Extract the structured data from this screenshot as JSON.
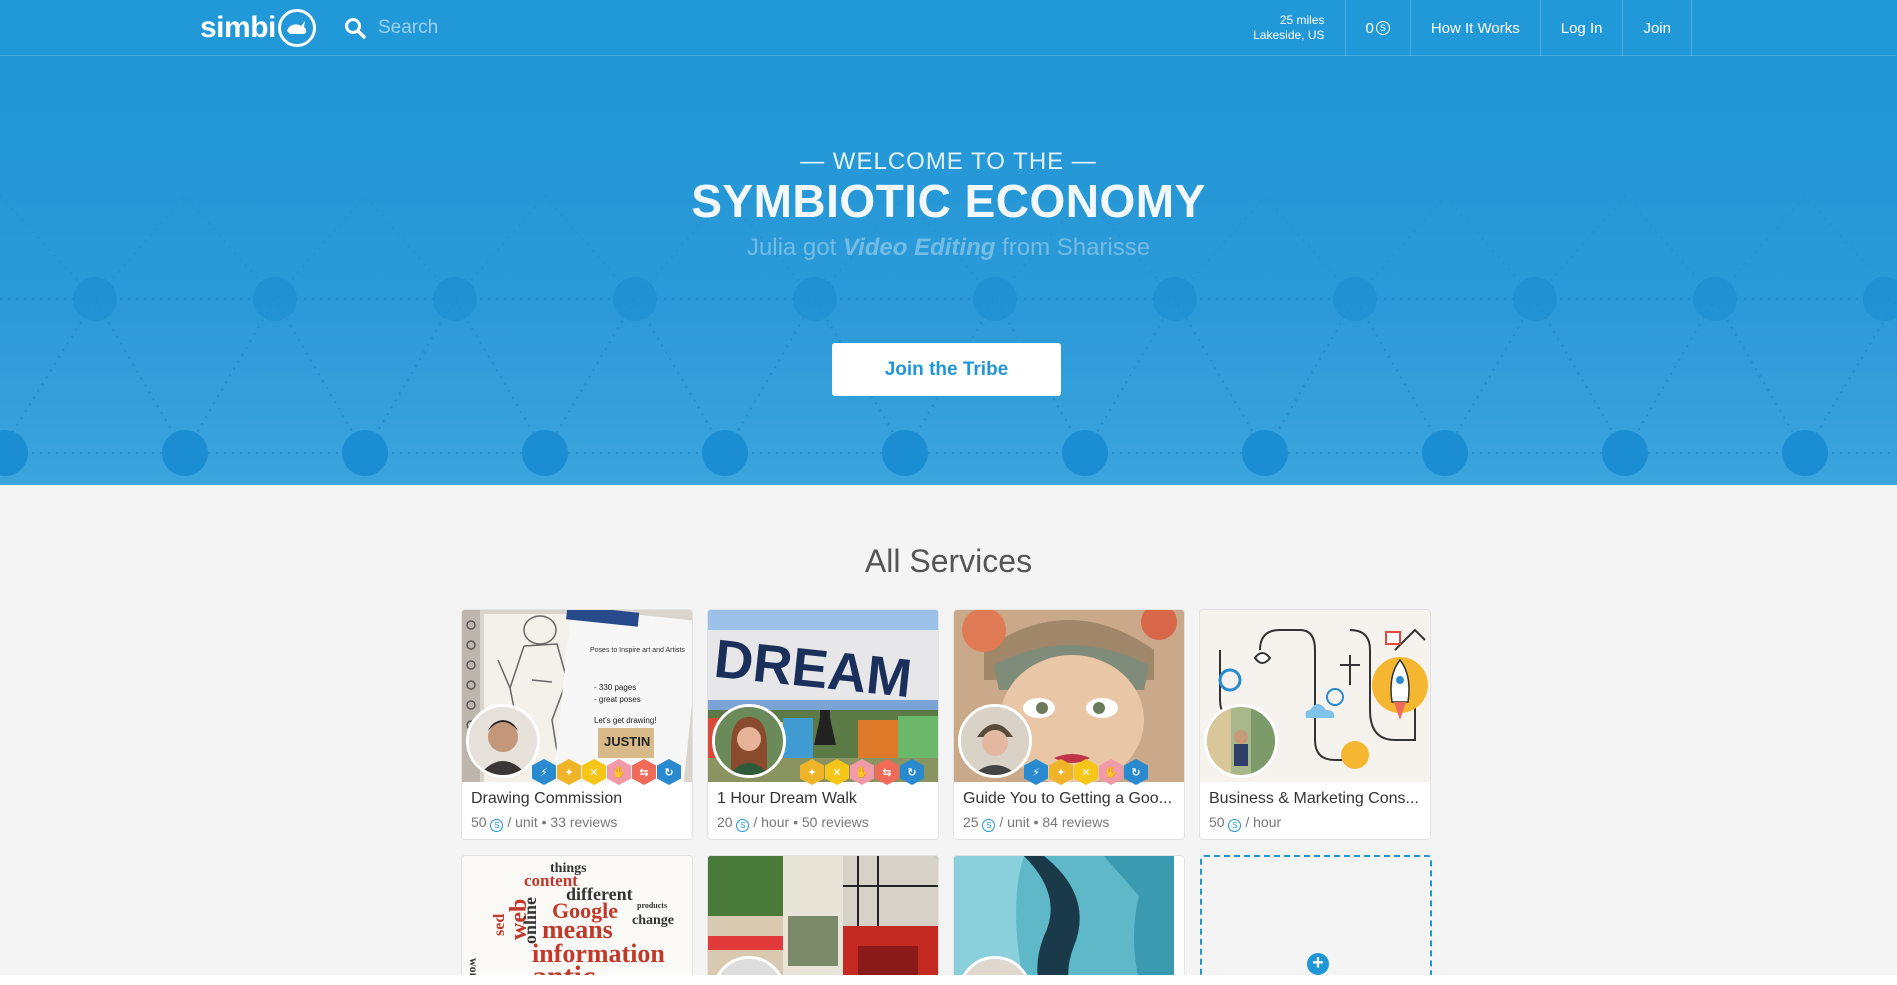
{
  "nav": {
    "logo_text": "simbi",
    "search_placeholder": "Search",
    "distance": "25 miles",
    "location": "Lakeside, US",
    "balance": "0",
    "how_it_works": "How It Works",
    "log_in": "Log In",
    "join": "Join"
  },
  "hero": {
    "kicker": "— WELCOME TO THE —",
    "title": "SYMBIOTIC ECONOMY",
    "sub_prefix": "Julia got ",
    "sub_service": "Video Editing",
    "sub_suffix": " from Sharisse",
    "cta": "Join the Tribe"
  },
  "services": {
    "heading": "All Services",
    "cards": [
      {
        "title": "Drawing Commission",
        "price": "50",
        "unit": "/ unit",
        "reviews": "• 33 reviews"
      },
      {
        "title": "1 Hour Dream Walk",
        "price": "20",
        "unit": "/ hour",
        "reviews": "• 50 reviews"
      },
      {
        "title": "Guide You to Getting a Goo...",
        "price": "25",
        "unit": "/ unit",
        "reviews": "• 84 reviews"
      },
      {
        "title": "Business & Marketing Cons...",
        "price": "50",
        "unit": "/ hour",
        "reviews": ""
      }
    ],
    "thumb_text": {
      "dream": "DREAM",
      "sketch_notes": "Poses to Inspire art and Artists",
      "sketch_pages": "- 330 pages",
      "sketch_poses": "- great poses",
      "sketch_draw": "Let's get drawing!",
      "sketch_name": "JUSTIN",
      "words": [
        "things",
        "content",
        "different",
        "Google",
        "means",
        "web",
        "online",
        "sed",
        "information",
        "change",
        "products",
        "antic",
        "word"
      ]
    }
  },
  "icons": {
    "coin_glyph": "S",
    "add": "+"
  },
  "colors": {
    "brand": "#2198d8",
    "badge_blue": "#2a8ad0",
    "badge_gold": "#f0b429",
    "badge_yellow": "#f5c518",
    "badge_pink": "#f39aa8",
    "badge_coral": "#f06a5a"
  }
}
